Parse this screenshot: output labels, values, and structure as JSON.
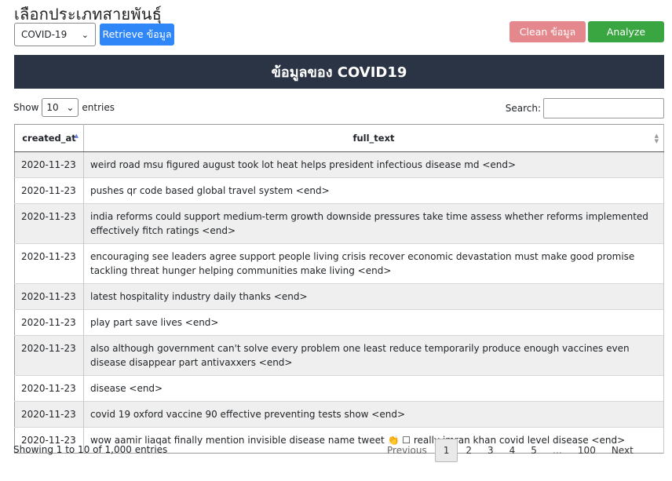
{
  "header": {
    "title": "เลือกประเภทสายพันธุ์",
    "strain_select_value": "COVID-19",
    "retrieve_label": "Retrieve ข้อมูล",
    "clean_label": "Clean ข้อมูล",
    "analyze_label": "Analyze",
    "banner": "ข้อมูลของ COVID19"
  },
  "controls": {
    "show_label": "Show",
    "entries_value": "10",
    "entries_label": "entries",
    "search_label": "Search:"
  },
  "table": {
    "columns": [
      "created_at",
      "full_text"
    ],
    "rows": [
      [
        "2020-11-23",
        "weird road msu figured august took lot heat helps president infectious disease md <end>"
      ],
      [
        "2020-11-23",
        "pushes qr code based global travel system <end>"
      ],
      [
        "2020-11-23",
        "india reforms could support medium-term growth downside pressures take time assess whether reforms implemented effectively fitch ratings <end>"
      ],
      [
        "2020-11-23",
        "encouraging see leaders agree support people living crisis recover economic devastation must make good promise tackling threat hunger helping communities make living <end>"
      ],
      [
        "2020-11-23",
        "latest hospitality industry daily thanks <end>"
      ],
      [
        "2020-11-23",
        "play part save lives <end>"
      ],
      [
        "2020-11-23",
        "also although government can't solve every problem one least reduce temporarily produce enough vaccines even disease disappear part antivaxxers <end>"
      ],
      [
        "2020-11-23",
        "disease <end>"
      ],
      [
        "2020-11-23",
        "covid 19 oxford vaccine 90 effective preventing tests show <end>"
      ],
      [
        "2020-11-23",
        "wow aamir liaqat finally mention invisible disease name tweet 👏 ☐ really imran khan covid level disease <end>"
      ]
    ]
  },
  "footer": {
    "info": "Showing 1 to 10 of 1,000 entries",
    "previous": "Previous",
    "pages": [
      "1",
      "2",
      "3",
      "4",
      "5",
      "…",
      "100"
    ],
    "current_page": "1",
    "next": "Next"
  }
}
